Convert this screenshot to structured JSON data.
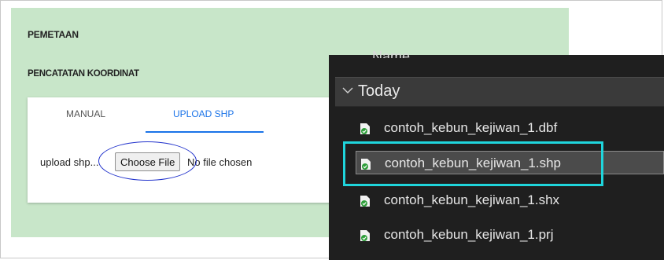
{
  "form": {
    "section_title": "PEMETAAN",
    "section_subtitle": "PENCATATAN KOORDINAT",
    "tabs": [
      {
        "label": "MANUAL",
        "active": false
      },
      {
        "label": "UPLOAD SHP",
        "active": true
      }
    ],
    "upload_label": "upload shp...",
    "choose_file_label": "Choose File",
    "no_file_text": "No file chosen"
  },
  "explorer": {
    "column_header": "Name",
    "group_label": "Today",
    "files": [
      {
        "name": "contoh_kebun_kejiwan_1.dbf",
        "selected": false
      },
      {
        "name": "contoh_kebun_kejiwan_1.shp",
        "selected": true
      },
      {
        "name": "contoh_kebun_kejiwan_1.shx",
        "selected": false
      },
      {
        "name": "contoh_kebun_kejiwan_1.prj",
        "selected": false
      }
    ]
  },
  "colors": {
    "panel_green": "#c8e6c9",
    "tab_active": "#1a73e8",
    "explorer_bg": "#1f1f1f",
    "highlight_cyan": "#1fd5dc",
    "highlight_oval": "#2233cc"
  }
}
